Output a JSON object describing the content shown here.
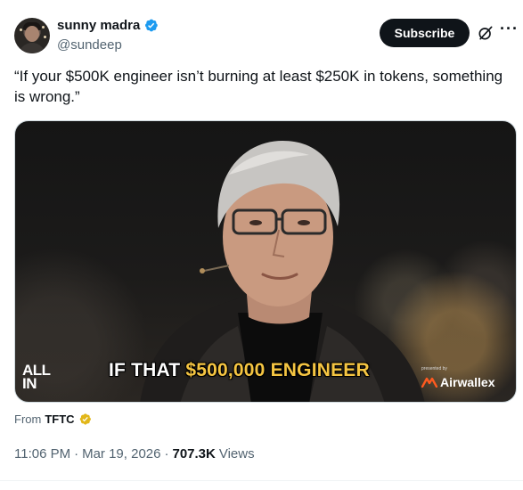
{
  "user": {
    "display_name": "sunny madra",
    "handle": "@sundeep",
    "verified_icon": "verified-badge-icon",
    "verified_color": "#1d9bf0"
  },
  "actions": {
    "subscribe_label": "Subscribe",
    "grok_icon": "grok-icon",
    "more_icon": "more-options-icon",
    "more_glyph": "···"
  },
  "tweet": {
    "text": "“If your $500K engineer isn’t burning at least $250K in tokens, something is wrong.”"
  },
  "media": {
    "overlay_logo": "ALL IN",
    "overlay_logo_line1": "ALL",
    "overlay_logo_line2": "IN",
    "caption_prefix": "IF THAT ",
    "caption_highlight": "$500,000 ENGINEER",
    "caption_highlight_color": "#f5c542",
    "presented_by": "presented by",
    "sponsor": "Airwallex",
    "sponsor_logo_color": "#ff5a1f"
  },
  "source": {
    "label": "From",
    "name": "TFTC",
    "badge_color": "#e2b719"
  },
  "meta": {
    "time": "11:06 PM",
    "sep1": "·",
    "date": "Mar 19, 2026",
    "sep2": "·",
    "views_count": "707.3K",
    "views_label": "Views"
  }
}
